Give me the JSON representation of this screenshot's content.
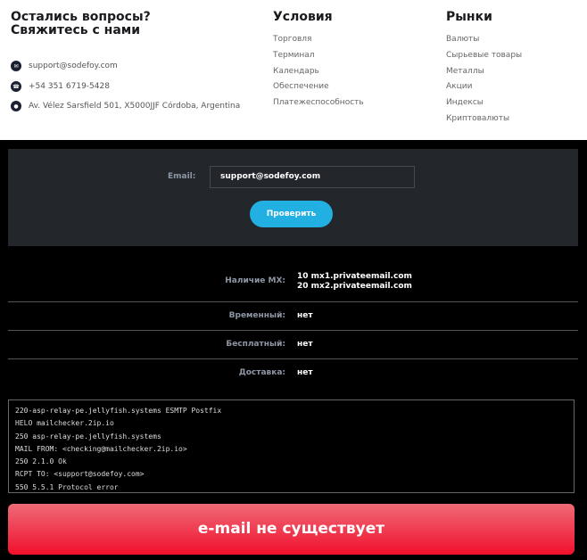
{
  "contact": {
    "title_line1": "Остались вопросы?",
    "title_line2": "Свяжитесь с нами",
    "email": "support@sodefoy.com",
    "phone": "+54 351 6719-5428",
    "address": "Av. Vélez Sarsfield 501, X5000JJF Córdoba, Argentina"
  },
  "conditions": {
    "title": "Условия",
    "items": [
      "Торговля",
      "Терминал",
      "Календарь",
      "Обеспечение",
      "Платежеспособность"
    ]
  },
  "markets": {
    "title": "Рынки",
    "items": [
      "Валюты",
      "Сырьевые товары",
      "Металлы",
      "Акции",
      "Индексы",
      "Криптовалюты"
    ]
  },
  "form": {
    "email_label": "Email:",
    "email_value": "support@sodefoy.com",
    "check_label": "Проверить"
  },
  "results": {
    "mx_label": "Наличие MX:",
    "mx_values": [
      "10 mx1.privateemail.com",
      "20 mx2.privateemail.com"
    ],
    "temp_label": "Временный:",
    "temp_value": "нет",
    "free_label": "Бесплатный:",
    "free_value": "нет",
    "delivery_label": "Доставка:",
    "delivery_value": "нет"
  },
  "log": [
    "220-asp-relay-pe.jellyfish.systems ESMTP Postfix",
    "HELO mailchecker.2ip.io",
    "250 asp-relay-pe.jellyfish.systems",
    "MAIL FROM: <checking@mailchecker.2ip.io>",
    "250 2.1.0 Ok",
    "RCPT TO: <support@sodefoy.com>",
    "550 5.5.1 Protocol error"
  ],
  "verdict": "e-mail не существует"
}
